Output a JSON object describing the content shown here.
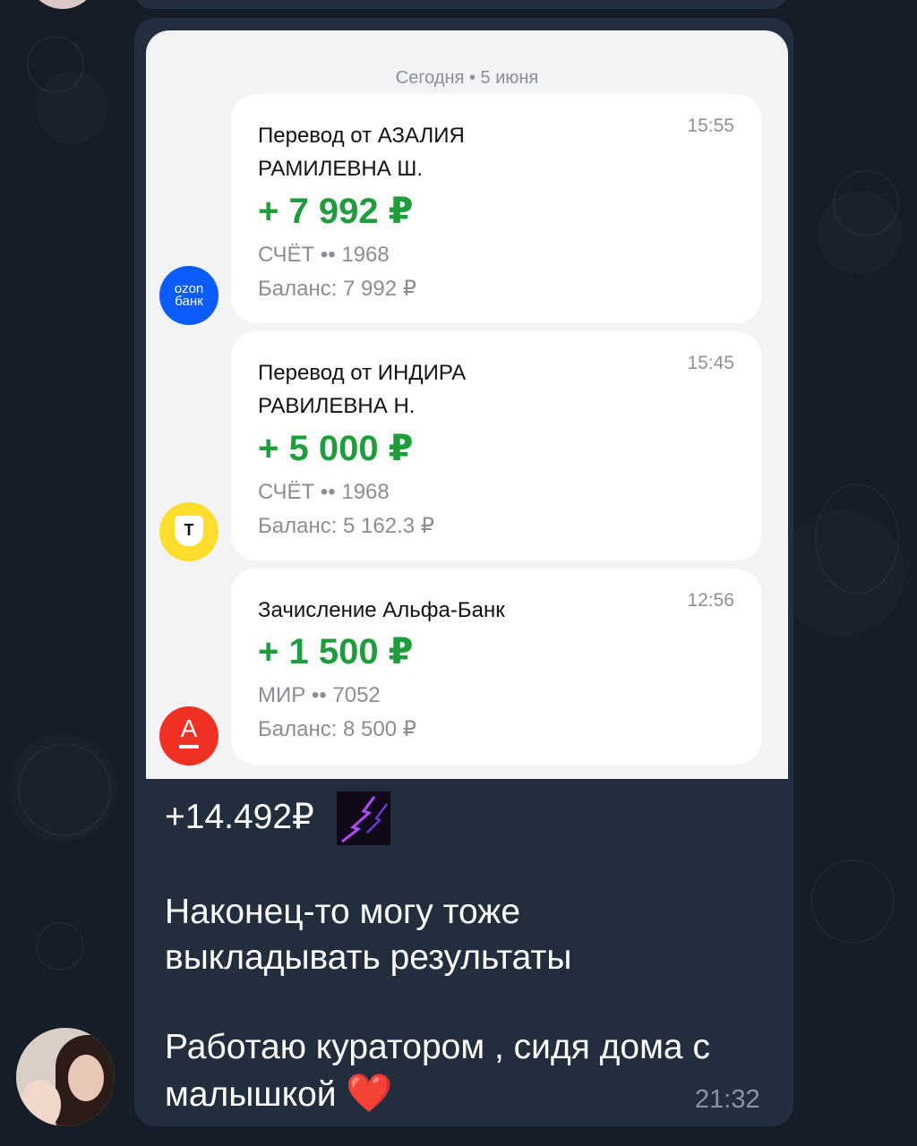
{
  "screenshot": {
    "date_header": "Сегодня • 5 июня",
    "transactions": [
      {
        "title": "Перевод от АЗАЛИЯ РАМИЛЕВНА Ш.",
        "time": "15:55",
        "amount": "+ 7 992 ₽",
        "account": "СЧЁТ •• 1968",
        "balance": "Баланс: 7 992 ₽",
        "bank_logo": {
          "name": "ozon-bank-icon",
          "line1": "ozon",
          "line2": "банк",
          "color": "#0a5cff"
        }
      },
      {
        "title": "Перевод от ИНДИРА РАВИЛЕВНА Н.",
        "time": "15:45",
        "amount": "+ 5 000 ₽",
        "account": "СЧЁТ •• 1968",
        "balance": "Баланс: 5 162.3 ₽",
        "bank_logo": {
          "name": "t-bank-icon",
          "letter": "Т",
          "color": "#ffdd2d"
        }
      },
      {
        "title": "Зачисление Альфа-Банк",
        "time": "12:56",
        "amount": "+ 1 500 ₽",
        "account": "МИР •• 7052",
        "balance": "Баланс: 8 500 ₽",
        "bank_logo": {
          "name": "alfa-bank-icon",
          "letter": "А",
          "color": "#ef3124"
        }
      }
    ],
    "colors": {
      "amount": "#1f9c3b",
      "card_bg": "#ffffff",
      "panel_bg": "#f2f3f5"
    }
  },
  "message": {
    "total": "+14.492₽",
    "sticker_icon": "purple-lightning-sticker",
    "text_paragraph1_line1": "Наконец-то могу тоже",
    "text_paragraph1_line2": "выкладывать результаты",
    "text_paragraph2_line1": "Работаю куратором , сидя дома с",
    "text_paragraph2_line2": "малышкой",
    "emoji": "❤️",
    "time": "21:32",
    "bubble_color": "#222e3d"
  },
  "chat": {
    "background_color": "#141d28"
  }
}
